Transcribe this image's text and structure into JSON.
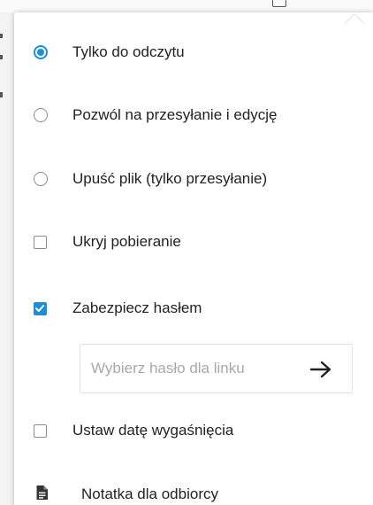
{
  "background": {
    "top_icon": "document-icon"
  },
  "menu": {
    "radio_options": [
      {
        "label": "Tylko do odczytu",
        "checked": true
      },
      {
        "label": "Pozwól na przesyłanie i edycję",
        "checked": false
      },
      {
        "label": "Upuść plik (tylko przesyłanie)",
        "checked": false
      }
    ],
    "hide_download": {
      "label": "Ukryj pobieranie",
      "checked": false
    },
    "password_protect": {
      "label": "Zabezpiecz hasłem",
      "checked": true
    },
    "password_field": {
      "placeholder": "Wybierz hasło dla linku",
      "value": "",
      "submit_icon": "arrow-right-icon"
    },
    "expiration": {
      "label": "Ustaw datę wygaśnięcia",
      "checked": false
    },
    "note": {
      "label": "Notatka dla odbiorcy",
      "icon": "note-icon"
    }
  },
  "colors": {
    "accent": "#1e8fd6",
    "text": "#222222",
    "placeholder": "#a8a8a8",
    "border": "#8c8c8c"
  }
}
